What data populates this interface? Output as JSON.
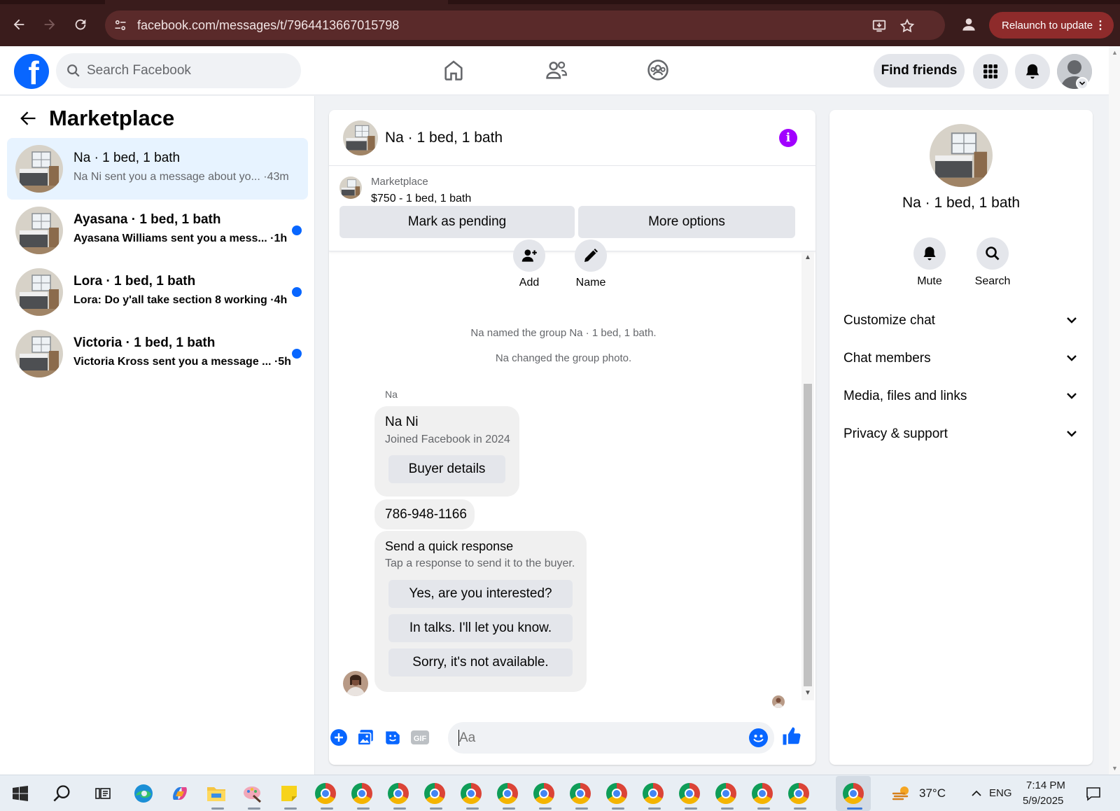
{
  "browser": {
    "url": "facebook.com/messages/t/7964413667015798",
    "relaunch_label": "Relaunch to update"
  },
  "header": {
    "search_placeholder": "Search Facebook",
    "find_friends_label": "Find friends"
  },
  "sidebar": {
    "title": "Marketplace",
    "conversations": [
      {
        "name": "Na · 1 bed, 1 bath",
        "preview": "Na Ni sent you a message about yo... ·43m",
        "unread": false,
        "active": true
      },
      {
        "name": "Ayasana · 1 bed, 1 bath",
        "preview": "Ayasana Williams sent you a mess... ·1h",
        "unread": true,
        "active": false
      },
      {
        "name": "Lora · 1 bed, 1 bath",
        "preview": "Lora: Do y'all take section 8 working ·4h",
        "unread": true,
        "active": false
      },
      {
        "name": "Victoria · 1 bed, 1 bath",
        "preview": "Victoria Kross sent you a message ... ·5h",
        "unread": true,
        "active": false
      }
    ]
  },
  "chat": {
    "title": "Na · 1 bed, 1 bath",
    "marketplace_label": "Marketplace",
    "listing": "$750 - 1 bed, 1 bath",
    "mark_pending_label": "Mark as pending",
    "more_options_label": "More options",
    "add_label": "Add",
    "name_label": "Name",
    "system_messages": [
      "Na named the group Na · 1 bed, 1 bath.",
      "Na changed the group photo."
    ],
    "sender": "Na",
    "profile_card": {
      "name": "Na Ni",
      "joined": "Joined Facebook in 2024",
      "button": "Buyer details"
    },
    "phone_message": "786-948-1166",
    "quick_response": {
      "title": "Send a quick response",
      "subtitle": "Tap a response to send it to the buyer.",
      "options": [
        "Yes, are you interested?",
        "In talks. I'll let you know.",
        "Sorry, it's not available."
      ]
    },
    "composer_placeholder": "Aa"
  },
  "details_panel": {
    "title": "Na · 1 bed, 1 bath",
    "mute_label": "Mute",
    "search_label": "Search",
    "sections": [
      "Customize chat",
      "Chat members",
      "Media, files and links",
      "Privacy & support"
    ]
  },
  "taskbar": {
    "temperature": "37°C",
    "language": "ENG",
    "time": "7:14 PM",
    "date": "5/9/2025"
  },
  "colors": {
    "facebook_blue": "#0866ff",
    "info_purple": "#a100ff",
    "browser_frame": "#3a1c1c",
    "relaunch": "#8e2b2b"
  }
}
